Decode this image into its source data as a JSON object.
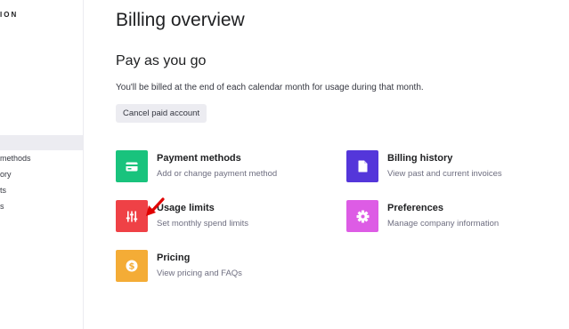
{
  "sidebar": {
    "brand": "ION",
    "items": [
      {
        "label": ""
      },
      {
        "label": "methods"
      },
      {
        "label": "ory"
      },
      {
        "label": "ts"
      },
      {
        "label": "s"
      }
    ]
  },
  "main": {
    "title": "Billing overview",
    "plan_heading": "Pay as you go",
    "plan_description": "You'll be billed at the end of each calendar month for usage during that month.",
    "cancel_button": "Cancel paid account"
  },
  "cards": [
    {
      "title": "Payment methods",
      "subtitle": "Add or change payment method",
      "color": "#19c37d",
      "icon": "credit-card-icon"
    },
    {
      "title": "Billing history",
      "subtitle": "View past and current invoices",
      "color": "#5436da",
      "icon": "document-icon"
    },
    {
      "title": "Usage limits",
      "subtitle": "Set monthly spend limits",
      "color": "#ef4146",
      "icon": "sliders-icon"
    },
    {
      "title": "Preferences",
      "subtitle": "Manage company information",
      "color": "#dd5ce5",
      "icon": "gear-icon"
    },
    {
      "title": "Pricing",
      "subtitle": "View pricing and FAQs",
      "color": "#f4ac36",
      "icon": "dollar-icon"
    }
  ],
  "colors": {
    "annotation_arrow": "#e00000",
    "active_nav_bg": "#ececf1"
  }
}
